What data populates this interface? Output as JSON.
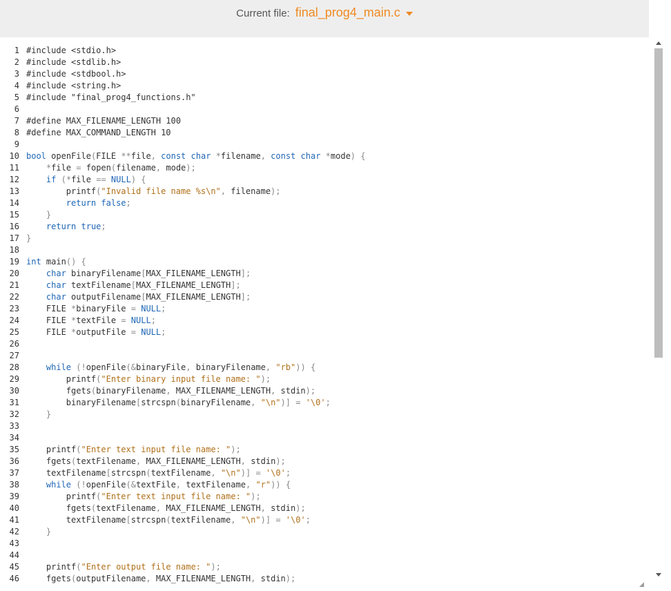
{
  "header": {
    "file_label": "Current file:",
    "file_name": "final_prog4_main.c",
    "dropdown_icon": "chevron-down-icon"
  },
  "colors": {
    "accent": "#f08a24",
    "keyword": "#1e66b6",
    "string": "#b0701a",
    "punctuation": "#888888",
    "header_bg": "#eeeeee"
  },
  "editor": {
    "lines": [
      {
        "n": "1",
        "text": "#include <stdio.h>"
      },
      {
        "n": "2",
        "text": "#include <stdlib.h>"
      },
      {
        "n": "3",
        "text": "#include <stdbool.h>"
      },
      {
        "n": "4",
        "text": "#include <string.h>"
      },
      {
        "n": "5",
        "text": "#include \"final_prog4_functions.h\""
      },
      {
        "n": "6",
        "text": ""
      },
      {
        "n": "7",
        "text": "#define MAX_FILENAME_LENGTH 100"
      },
      {
        "n": "8",
        "text": "#define MAX_COMMAND_LENGTH 10"
      },
      {
        "n": "9",
        "text": ""
      },
      {
        "n": "10",
        "text": "bool openFile(FILE **file, const char *filename, const char *mode) {"
      },
      {
        "n": "11",
        "text": "    *file = fopen(filename, mode);"
      },
      {
        "n": "12",
        "text": "    if (*file == NULL) {"
      },
      {
        "n": "13",
        "text": "        printf(\"Invalid file name %s\\n\", filename);"
      },
      {
        "n": "14",
        "text": "        return false;"
      },
      {
        "n": "15",
        "text": "    }"
      },
      {
        "n": "16",
        "text": "    return true;"
      },
      {
        "n": "17",
        "text": "}"
      },
      {
        "n": "18",
        "text": ""
      },
      {
        "n": "19",
        "text": "int main() {"
      },
      {
        "n": "20",
        "text": "    char binaryFilename[MAX_FILENAME_LENGTH];"
      },
      {
        "n": "21",
        "text": "    char textFilename[MAX_FILENAME_LENGTH];"
      },
      {
        "n": "22",
        "text": "    char outputFilename[MAX_FILENAME_LENGTH];"
      },
      {
        "n": "23",
        "text": "    FILE *binaryFile = NULL;"
      },
      {
        "n": "24",
        "text": "    FILE *textFile = NULL;"
      },
      {
        "n": "25",
        "text": "    FILE *outputFile = NULL;"
      },
      {
        "n": "26",
        "text": ""
      },
      {
        "n": "27",
        "text": ""
      },
      {
        "n": "28",
        "text": "    while (!openFile(&binaryFile, binaryFilename, \"rb\")) {"
      },
      {
        "n": "29",
        "text": "        printf(\"Enter binary input file name: \");"
      },
      {
        "n": "30",
        "text": "        fgets(binaryFilename, MAX_FILENAME_LENGTH, stdin);"
      },
      {
        "n": "31",
        "text": "        binaryFilename[strcspn(binaryFilename, \"\\n\")] = '\\0';"
      },
      {
        "n": "32",
        "text": "    }"
      },
      {
        "n": "33",
        "text": ""
      },
      {
        "n": "34",
        "text": ""
      },
      {
        "n": "35",
        "text": "    printf(\"Enter text input file name: \");"
      },
      {
        "n": "36",
        "text": "    fgets(textFilename, MAX_FILENAME_LENGTH, stdin);"
      },
      {
        "n": "37",
        "text": "    textFilename[strcspn(textFilename, \"\\n\")] = '\\0';"
      },
      {
        "n": "38",
        "text": "    while (!openFile(&textFile, textFilename, \"r\")) {"
      },
      {
        "n": "39",
        "text": "        printf(\"Enter text input file name: \");"
      },
      {
        "n": "40",
        "text": "        fgets(textFilename, MAX_FILENAME_LENGTH, stdin);"
      },
      {
        "n": "41",
        "text": "        textFilename[strcspn(textFilename, \"\\n\")] = '\\0';"
      },
      {
        "n": "42",
        "text": "    }"
      },
      {
        "n": "43",
        "text": ""
      },
      {
        "n": "44",
        "text": ""
      },
      {
        "n": "45",
        "text": "    printf(\"Enter output file name: \");"
      },
      {
        "n": "46",
        "text": "    fgets(outputFilename, MAX_FILENAME_LENGTH, stdin);"
      }
    ]
  },
  "scrollbar": {
    "up_icon": "scroll-up-arrow-icon",
    "down_icon": "scroll-down-arrow-icon",
    "resize_icon": "resize-grip-icon"
  }
}
